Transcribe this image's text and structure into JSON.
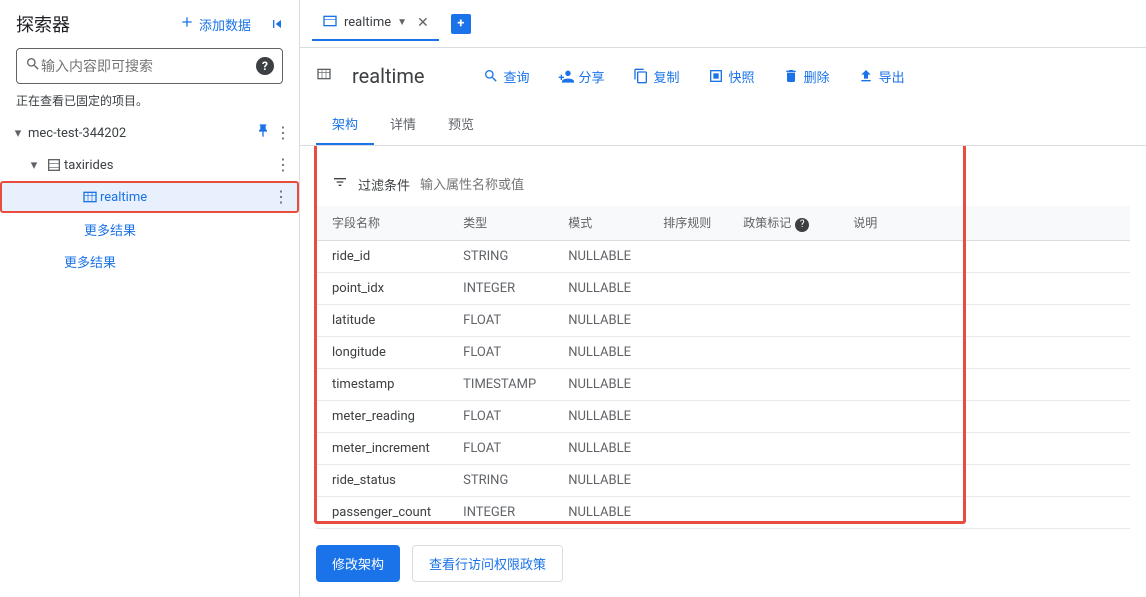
{
  "sidebar": {
    "title": "探索器",
    "add_data": "添加数据",
    "search_placeholder": "输入内容即可搜索",
    "pinned_msg": "正在查看已固定的项目。",
    "project": "mec-test-344202",
    "dataset": "taxirides",
    "table": "realtime",
    "more_results": "更多结果"
  },
  "tab": {
    "label": "realtime"
  },
  "toolbar": {
    "table_name": "realtime",
    "query": "查询",
    "share": "分享",
    "copy": "复制",
    "snapshot": "快照",
    "delete": "删除",
    "export": "导出"
  },
  "subtabs": {
    "schema": "架构",
    "details": "详情",
    "preview": "预览"
  },
  "filter": {
    "label": "过滤条件",
    "placeholder": "输入属性名称或值"
  },
  "columns": {
    "field": "字段名称",
    "type": "类型",
    "mode": "模式",
    "collation": "排序规则",
    "policy": "政策标记",
    "desc": "说明"
  },
  "schema": [
    {
      "name": "ride_id",
      "type": "STRING",
      "mode": "NULLABLE"
    },
    {
      "name": "point_idx",
      "type": "INTEGER",
      "mode": "NULLABLE"
    },
    {
      "name": "latitude",
      "type": "FLOAT",
      "mode": "NULLABLE"
    },
    {
      "name": "longitude",
      "type": "FLOAT",
      "mode": "NULLABLE"
    },
    {
      "name": "timestamp",
      "type": "TIMESTAMP",
      "mode": "NULLABLE"
    },
    {
      "name": "meter_reading",
      "type": "FLOAT",
      "mode": "NULLABLE"
    },
    {
      "name": "meter_increment",
      "type": "FLOAT",
      "mode": "NULLABLE"
    },
    {
      "name": "ride_status",
      "type": "STRING",
      "mode": "NULLABLE"
    },
    {
      "name": "passenger_count",
      "type": "INTEGER",
      "mode": "NULLABLE"
    }
  ],
  "buttons": {
    "edit_schema": "修改架构",
    "row_policy": "查看行访问权限政策"
  }
}
